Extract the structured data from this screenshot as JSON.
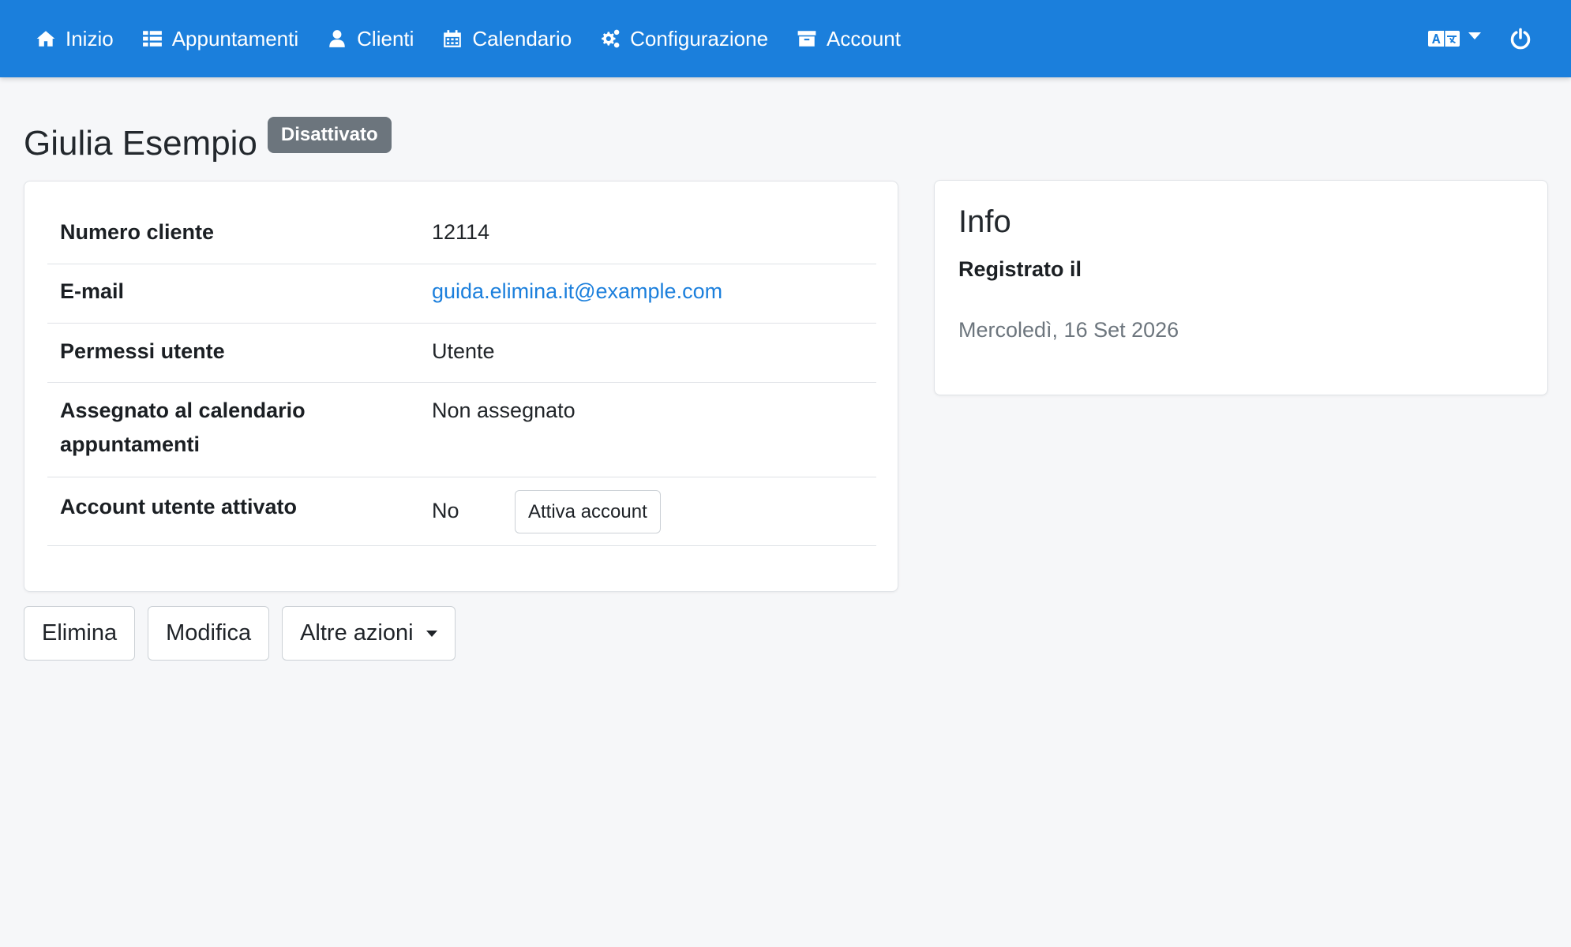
{
  "nav": {
    "items": [
      {
        "label": "Inizio",
        "icon": "home-icon"
      },
      {
        "label": "Appuntamenti",
        "icon": "list-icon"
      },
      {
        "label": "Clienti",
        "icon": "user-icon"
      },
      {
        "label": "Calendario",
        "icon": "calendar-icon"
      },
      {
        "label": "Configurazione",
        "icon": "gears-icon"
      },
      {
        "label": "Account",
        "icon": "archive-icon"
      }
    ],
    "language_icon": "language-icon",
    "power_icon": "power-icon",
    "bar_color": "#1b7fdc"
  },
  "page": {
    "title": "Giulia Esempio",
    "status": "Disattivato"
  },
  "details": {
    "rows": [
      {
        "label": "Numero cliente",
        "value": "12114"
      },
      {
        "label": "E-mail",
        "value": "guida.elimina.it@example.com"
      },
      {
        "label": "Permessi utente",
        "value": "Utente"
      },
      {
        "label": "Assegnato al calendario appuntamenti",
        "value": "Non assegnato"
      },
      {
        "label": "Account utente attivato",
        "value": "No"
      }
    ],
    "activate_button": "Attiva account"
  },
  "info": {
    "title": "Info",
    "registered_label": "Registrato il",
    "registered_value": "Mercoledì, 16 Set 2026"
  },
  "actions": {
    "delete": "Elimina",
    "edit": "Modifica",
    "more": "Altre azioni"
  }
}
